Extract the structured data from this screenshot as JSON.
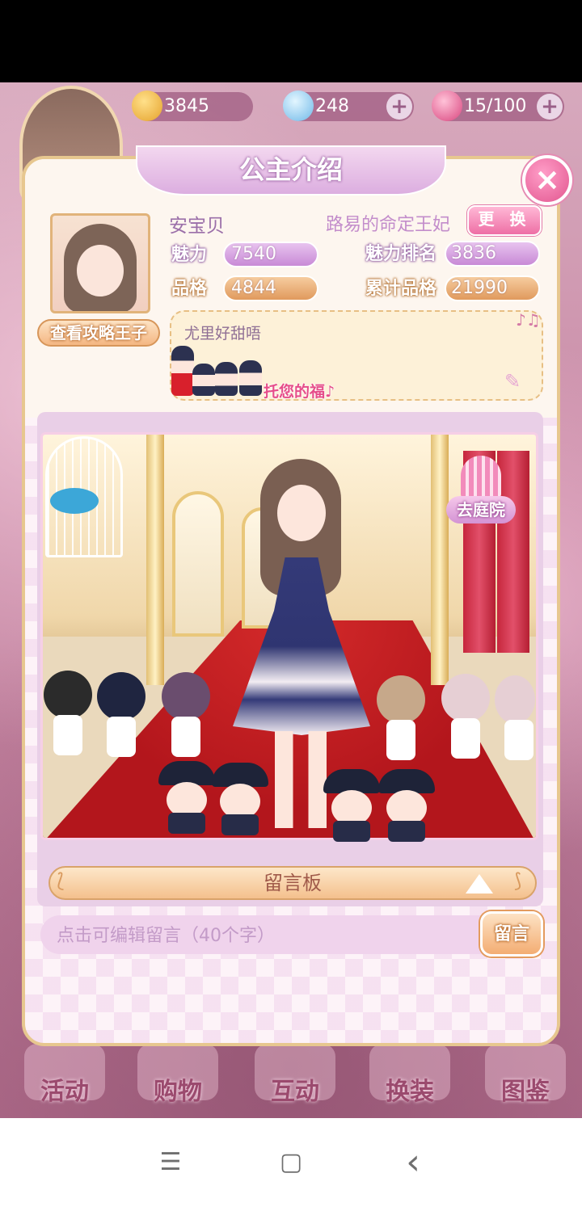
{
  "resources": {
    "coins": "3845",
    "diamonds": "248",
    "stamina": "15/100",
    "colors": {
      "coin": "#f2b23a",
      "diamond": "#7fc7f0",
      "stamina": "#e46693"
    }
  },
  "bottom_nav": [
    {
      "label": "活动"
    },
    {
      "label": "购物"
    },
    {
      "label": "互动"
    },
    {
      "label": "换装"
    },
    {
      "label": "图鉴"
    }
  ],
  "dialog": {
    "title": "公主介绍",
    "close_icon": "×",
    "profile": {
      "name": "安宝贝",
      "title": "路易的命定王妃",
      "change_label": "更 换",
      "view_prince_label": "查看攻略王子"
    },
    "stats": {
      "charm_label": "魅力",
      "charm_value": "7540",
      "charm_rank_label": "魅力排名",
      "charm_rank_value": "3836",
      "quality_label": "品格",
      "quality_value": "4844",
      "total_quality_label": "累计品格",
      "total_quality_value": "21990"
    },
    "signature": {
      "text": "尤里好甜唔",
      "sticker_text": "托您的福♪",
      "notes_icon": "♪♫",
      "edit_icon": "✎"
    },
    "scene": {
      "garden_label": "去庭院"
    },
    "message_board": {
      "label": "留言板",
      "input_placeholder": "点击可编辑留言（40个字）",
      "send_label": "留言"
    }
  },
  "system_nav": {
    "menu_icon": "☰",
    "home_icon": "▢",
    "back_icon": "‹"
  }
}
